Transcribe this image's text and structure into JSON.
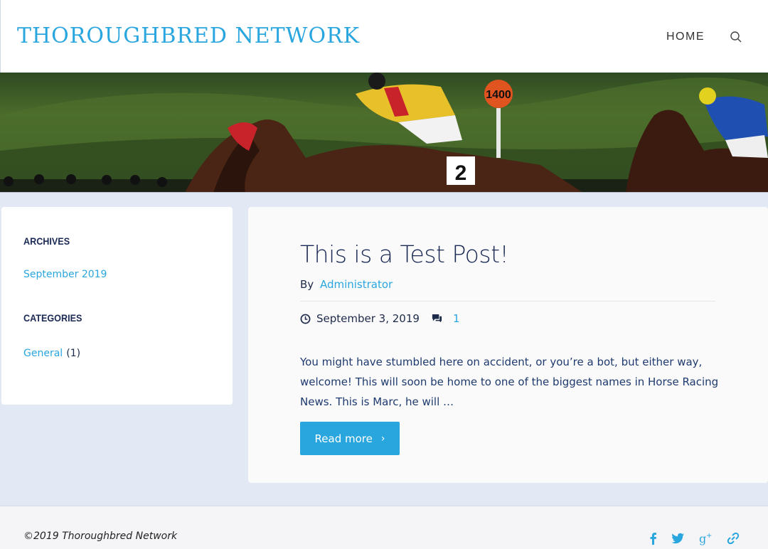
{
  "header": {
    "site_title": "THOROUGHBRED NETWORK",
    "nav": {
      "home_label": "HOME"
    },
    "search_icon": "search-icon"
  },
  "hero": {
    "image_description_icon": "horse-racing-image",
    "post_number": "1400",
    "saddle_number": "2"
  },
  "sidebar": {
    "archives": {
      "title": "ARCHIVES",
      "items": [
        {
          "label": "September 2019"
        }
      ]
    },
    "categories": {
      "title": "CATEGORIES",
      "items": [
        {
          "label": "General",
          "count": "(1)"
        }
      ]
    }
  },
  "post": {
    "title": "This is a Test Post!",
    "byline_prefix": "By",
    "author": "Administrator",
    "date": "September 3, 2019",
    "comment_count": "1",
    "excerpt": "You might have stumbled here on accident, or you’re a bot, but either way, welcome! This will soon be home to one of the biggest names in Horse Racing News. This is Marc, he will …",
    "read_more_label": "Read more",
    "read_more_icon": "chevron-right-icon"
  },
  "footer": {
    "copyright": "©2019 Thoroughbred Network",
    "social": [
      "facebook-icon",
      "twitter-icon",
      "google-plus-icon",
      "link-icon"
    ]
  },
  "colors": {
    "accent": "#2aa6df",
    "title_dark": "#1b2a55",
    "background": "#e2e8f4"
  }
}
